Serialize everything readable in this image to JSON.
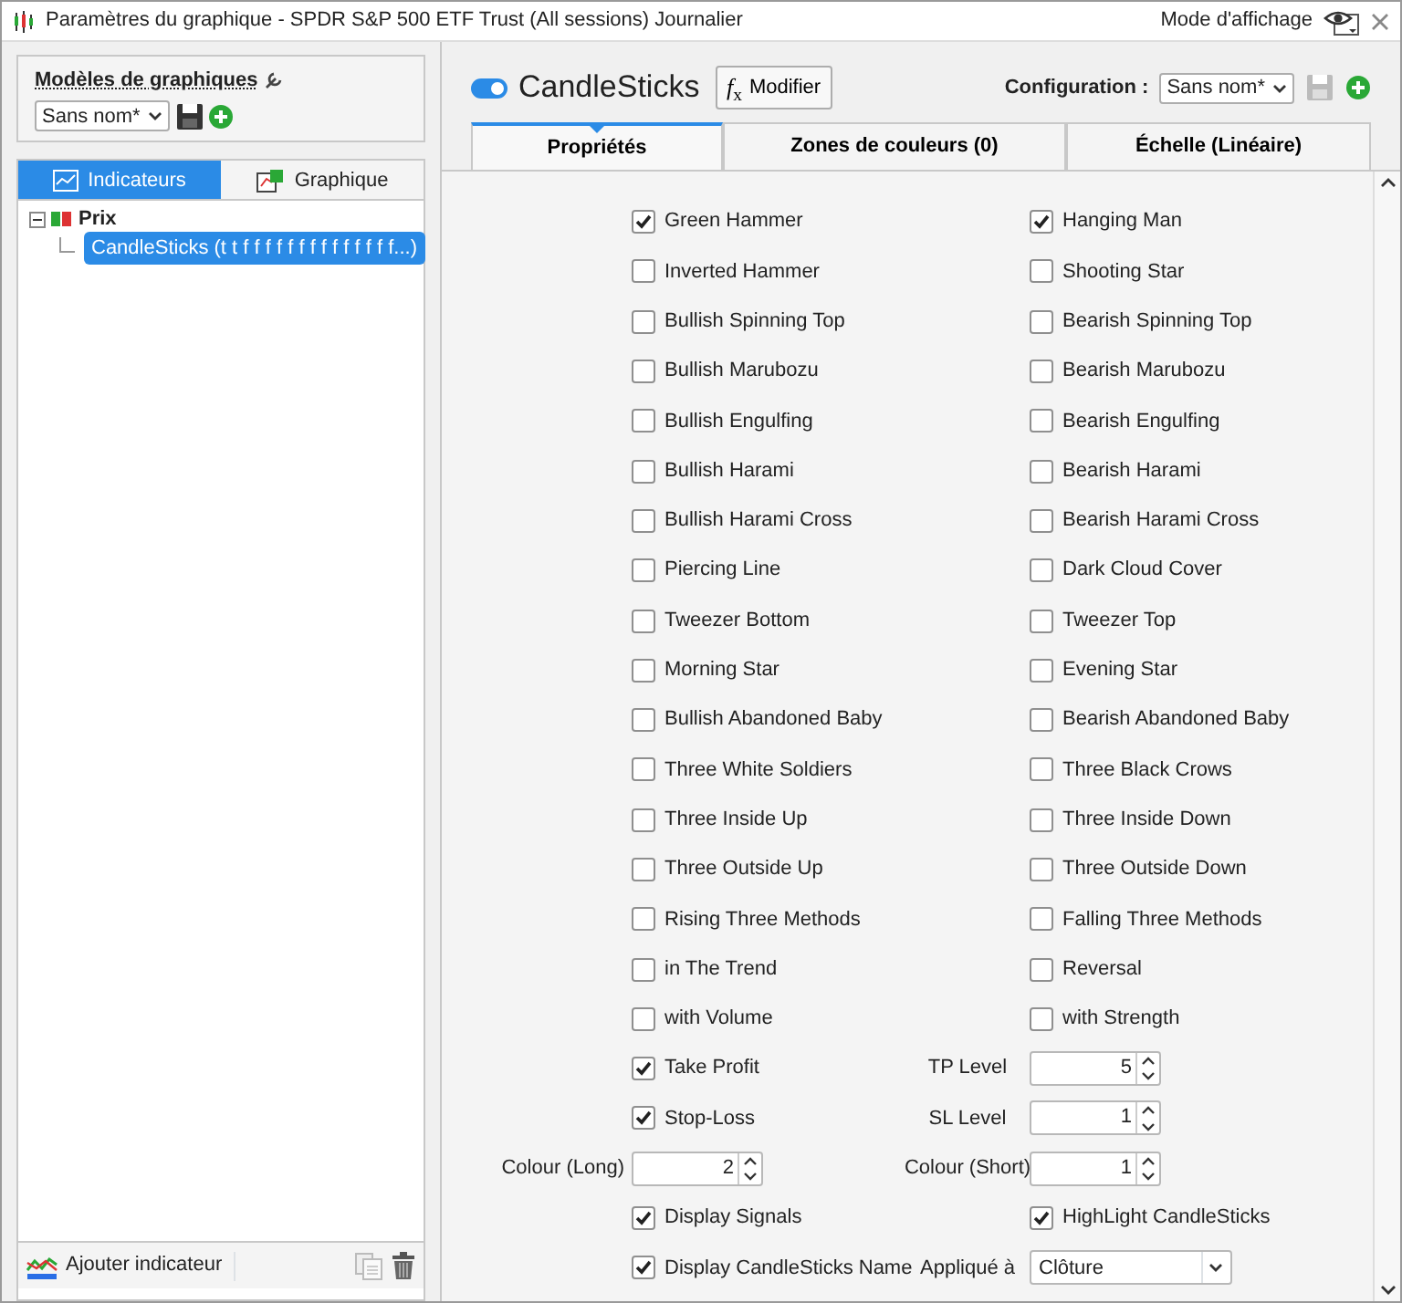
{
  "window": {
    "title": "Paramètres du graphique - SPDR S&P 500 ETF Trust (All sessions) Journalier",
    "view_mode": "Mode d'affichage"
  },
  "templates": {
    "title": "Modèles de graphiques",
    "value": "Sans nom*"
  },
  "left_tabs": [
    {
      "label": "Indicateurs",
      "selected": true
    },
    {
      "label": "Graphique",
      "selected": false
    }
  ],
  "tree": [
    {
      "label": "Prix",
      "expanded": true,
      "children": [
        {
          "label": "CandleSticks (t t f f f f f f f f f f f f f f...)",
          "selected": true
        }
      ]
    }
  ],
  "left_footer": {
    "add_label": "Ajouter indicateur"
  },
  "indicator": {
    "name": "CandleSticks",
    "enabled": true,
    "formula_symbol": "*f*$_{x}$",
    "modify_label": "Modifier"
  },
  "configuration": {
    "label": "Configuration :",
    "value": "Sans nom*"
  },
  "tabs": [
    {
      "label": "Propriétés",
      "selected": true
    },
    {
      "label": "Zones de couleurs (0)",
      "selected": false
    },
    {
      "label": "Échelle (Linéaire)",
      "selected": false
    }
  ],
  "patterns": [
    {
      "label": "Green Hammer",
      "checked": true
    },
    {
      "label": "Hanging Man",
      "checked": true
    },
    {
      "label": "Inverted Hammer",
      "checked": false
    },
    {
      "label": "Shooting Star",
      "checked": false
    },
    {
      "label": "Bullish Spinning Top",
      "checked": false
    },
    {
      "label": "Bearish Spinning Top",
      "checked": false
    },
    {
      "label": "Bullish Marubozu",
      "checked": false
    },
    {
      "label": "Bearish Marubozu",
      "checked": false
    },
    {
      "label": "Bullish Engulfing",
      "checked": false
    },
    {
      "label": "Bearish Engulfing",
      "checked": false
    },
    {
      "label": "Bullish Harami",
      "checked": false
    },
    {
      "label": "Bearish Harami",
      "checked": false
    },
    {
      "label": "Bullish Harami Cross",
      "checked": false
    },
    {
      "label": "Bearish Harami Cross",
      "checked": false
    },
    {
      "label": "Piercing Line",
      "checked": false
    },
    {
      "label": "Dark Cloud Cover",
      "checked": false
    },
    {
      "label": "Tweezer Bottom",
      "checked": false
    },
    {
      "label": "Tweezer Top",
      "checked": false
    },
    {
      "label": "Morning Star",
      "checked": false
    },
    {
      "label": "Evening Star",
      "checked": false
    },
    {
      "label": "Bullish Abandoned Baby",
      "checked": false
    },
    {
      "label": "Bearish Abandoned Baby",
      "checked": false
    },
    {
      "label": "Three White Soldiers",
      "checked": false
    },
    {
      "label": "Three Black Crows",
      "checked": false
    },
    {
      "label": "Three Inside Up",
      "checked": false
    },
    {
      "label": "Three Inside Down",
      "checked": false
    },
    {
      "label": "Three Outside Up",
      "checked": false
    },
    {
      "label": "Three Outside Down",
      "checked": false
    },
    {
      "label": "Rising Three Methods",
      "checked": false
    },
    {
      "label": "Falling Three Methods",
      "checked": false
    },
    {
      "label": "in The Trend",
      "checked": false
    },
    {
      "label": "Reversal",
      "checked": false
    },
    {
      "label": "with Volume",
      "checked": false
    },
    {
      "label": "with Strength",
      "checked": false
    }
  ],
  "settings": [
    {
      "kind": "checkbox",
      "label": "Take Profit",
      "checked": true
    },
    {
      "kind": "spinner",
      "label": "TP Level",
      "value": "5"
    },
    {
      "kind": "checkbox",
      "label": "Stop-Loss",
      "checked": true
    },
    {
      "kind": "spinner",
      "label": "SL Level",
      "value": "1"
    },
    {
      "kind": "spinner",
      "label": "Colour (Long)",
      "value": "2"
    },
    {
      "kind": "spinner",
      "label": "Colour (Short)",
      "value": "1"
    },
    {
      "kind": "checkbox",
      "label": "Display Signals",
      "checked": true
    },
    {
      "kind": "checkbox",
      "label": "HighLight CandleSticks",
      "checked": true
    },
    {
      "kind": "checkbox",
      "label": "Display CandleSticks Name",
      "checked": true
    },
    {
      "kind": "select",
      "label": "Appliqué à",
      "value": "Clôture"
    }
  ]
}
